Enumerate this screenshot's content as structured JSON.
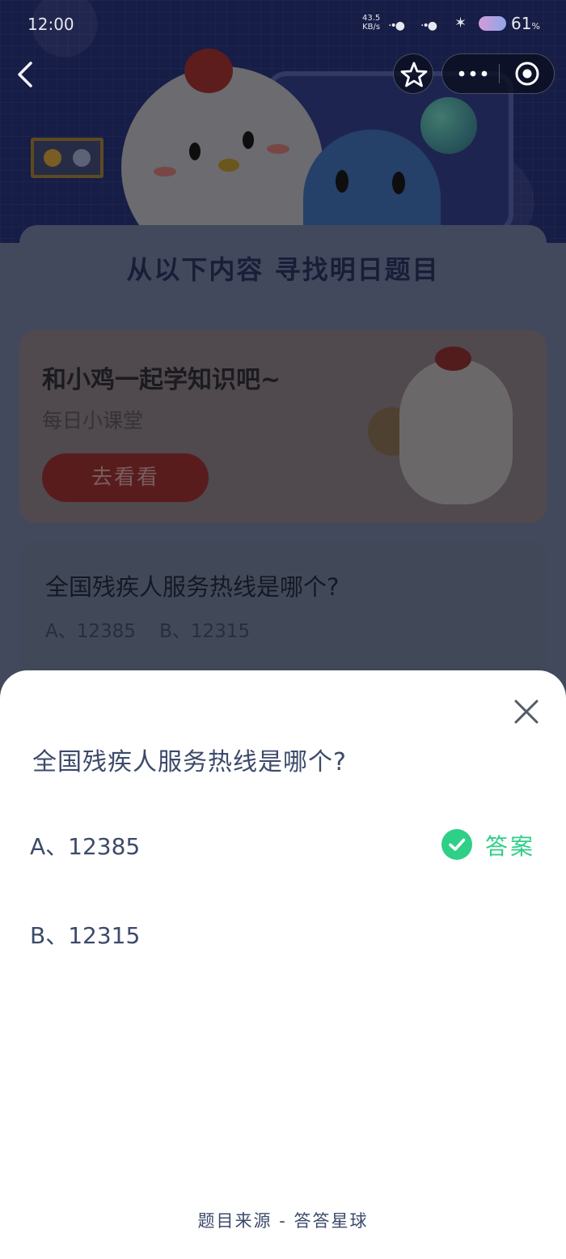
{
  "status_bar": {
    "time": "12:00",
    "speed_value": "43.5",
    "speed_unit": "KB/s",
    "battery": "61"
  },
  "background": {
    "banner_title": "从以下内容 寻找明日题目",
    "chick_card": {
      "title": "和小鸡一起学知识吧~",
      "subtitle": "每日小课堂",
      "button": "去看看"
    },
    "question_card": {
      "question": "全国残疾人服务热线是哪个?",
      "options_line": "A、12385    B、12315"
    }
  },
  "sheet": {
    "question": "全国残疾人服务热线是哪个?",
    "options": [
      {
        "label": "A、12385",
        "is_answer": true
      },
      {
        "label": "B、12315",
        "is_answer": false
      }
    ],
    "answer_label": "答案",
    "footer": "题目来源 - 答答星球"
  },
  "colors": {
    "accent_green": "#2ecf87",
    "text": "#3c4a6a"
  },
  "icons": {
    "nav_back": "chevron-left-icon",
    "favorite": "star-icon",
    "more": "more-dots-icon",
    "close_program": "target-circle-icon",
    "sheet_close": "close-icon",
    "answer_check": "check-circle-icon"
  }
}
